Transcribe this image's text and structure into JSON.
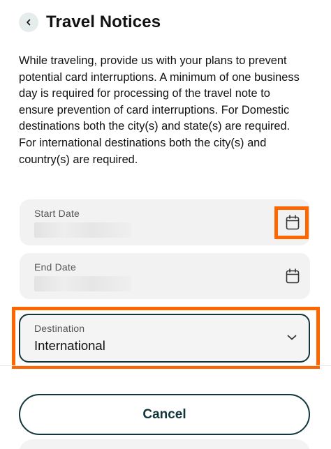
{
  "header": {
    "title": "Travel Notices",
    "back_icon": "chevron-left-icon"
  },
  "intro_text": "While traveling, provide us with your plans to prevent potential card interruptions. A minimum of one business day is required for processing of the travel note to ensure prevention of card interruptions. For Domestic destinations both the city(s) and state(s) are required. For international destinations both the city(s) and country(s) are required.",
  "form": {
    "start_date": {
      "label": "Start Date",
      "icon": "calendar-icon"
    },
    "end_date": {
      "label": "End Date",
      "icon": "calendar-icon"
    },
    "destination": {
      "label": "Destination",
      "value": "International",
      "icon": "chevron-down-icon"
    }
  },
  "actions": {
    "cancel_label": "Cancel"
  },
  "colors": {
    "primary_dark": "#13353c",
    "highlight": "#ff6600",
    "field_bg": "#f2f2f2"
  }
}
